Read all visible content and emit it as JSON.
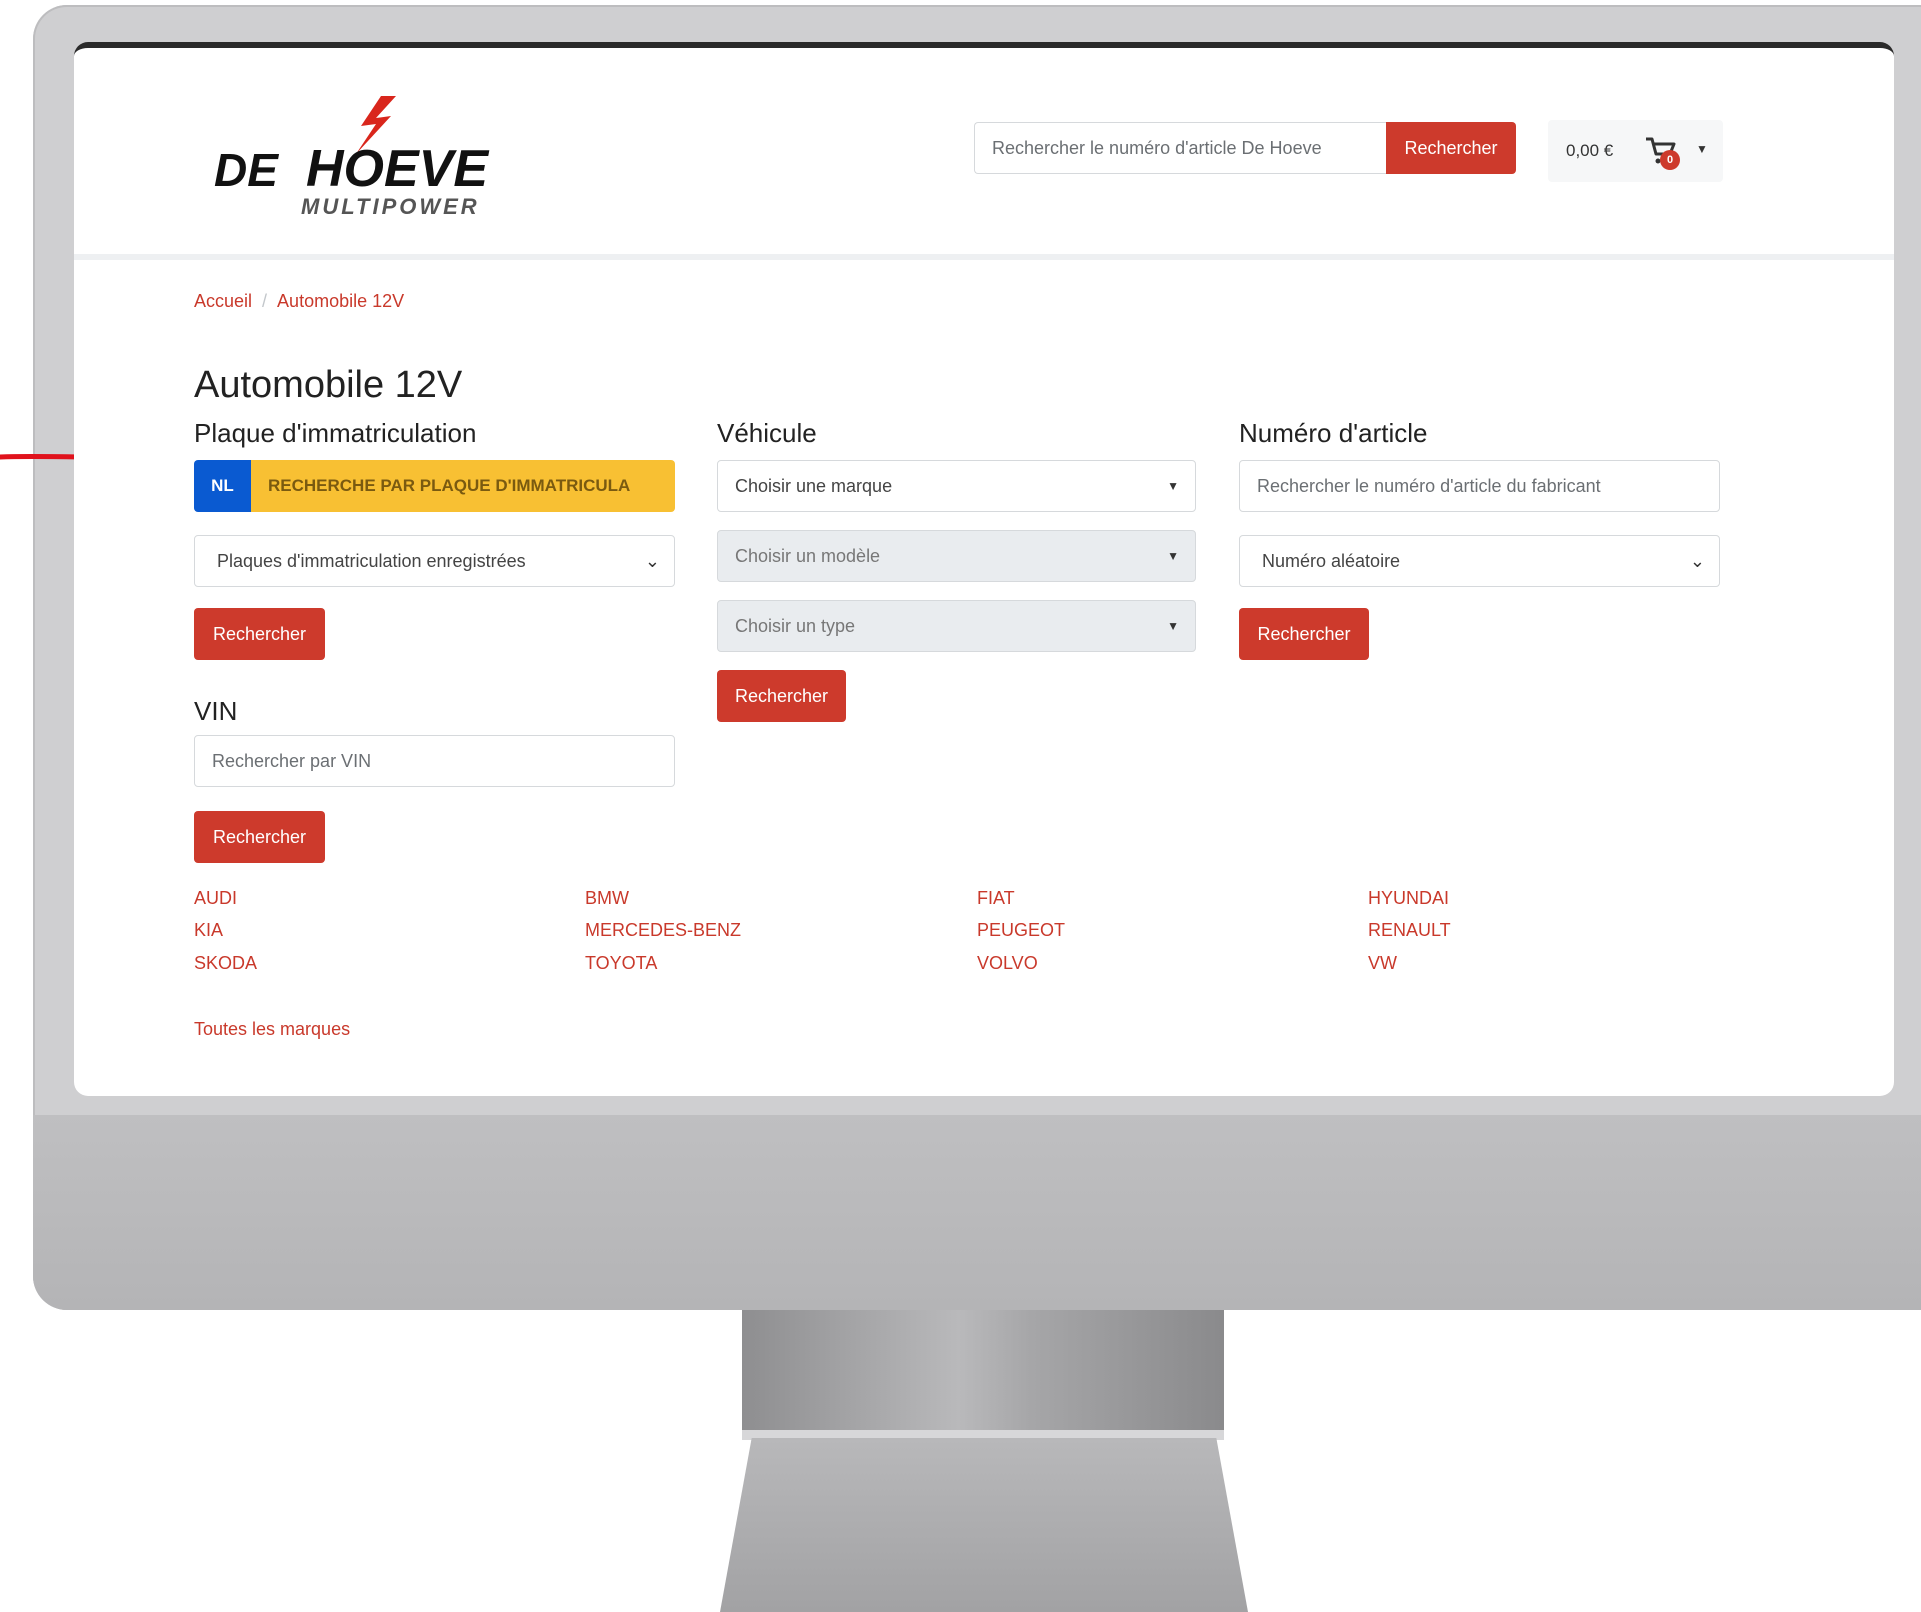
{
  "logo": {
    "line1": "DE",
    "line2": "HOEVE",
    "line3": "MULTIPOWER"
  },
  "header": {
    "search_placeholder": "Rechercher le numéro d'article De Hoeve",
    "search_button": "Rechercher",
    "cart_amount": "0,00 €",
    "cart_count": "0"
  },
  "breadcrumb": {
    "home": "Accueil",
    "separator": "/",
    "current": "Automobile 12V"
  },
  "page_title": "Automobile 12V",
  "plate_section": {
    "heading": "Plaque d'immatriculation",
    "country": "NL",
    "plate_label": "RECHERCHE PAR PLAQUE D'IMMATRICULA",
    "saved_plates": "Plaques d'immatriculation enregistrées",
    "button": "Rechercher"
  },
  "vin_section": {
    "heading": "VIN",
    "placeholder": "Rechercher par VIN",
    "button": "Rechercher"
  },
  "vehicle_section": {
    "heading": "Véhicule",
    "brand": "Choisir une marque",
    "model": "Choisir un modèle",
    "type": "Choisir un type",
    "button": "Rechercher"
  },
  "article_section": {
    "heading": "Numéro d'article",
    "placeholder": "Rechercher le numéro d'article du fabricant",
    "select": "Numéro aléatoire",
    "button": "Rechercher"
  },
  "brands": [
    "AUDI",
    "BMW",
    "FIAT",
    "HYUNDAI",
    "KIA",
    "MERCEDES-BENZ",
    "PEUGEOT",
    "RENAULT",
    "SKODA",
    "TOYOTA",
    "VOLVO",
    "VW"
  ],
  "all_brands": "Toutes les marques",
  "colors": {
    "accent": "#cd3a2c",
    "plate_blue": "#0a5ad1",
    "plate_yellow": "#f8c033",
    "annotation": "#e0121c"
  }
}
